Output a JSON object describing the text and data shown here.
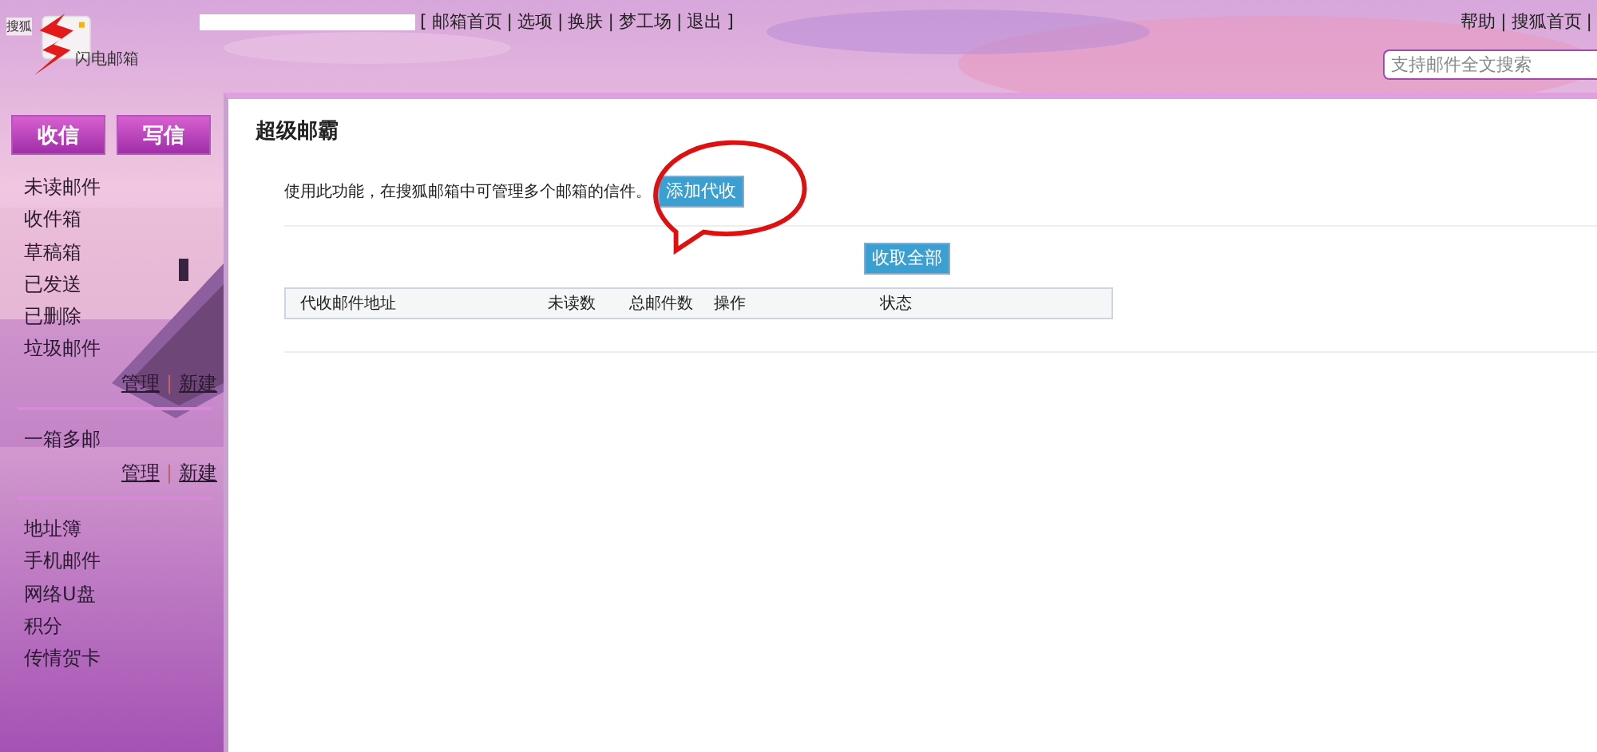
{
  "header": {
    "logo": {
      "brand": "搜狐",
      "product": "闪电邮箱"
    },
    "nav": {
      "open": "[",
      "separator": "|",
      "close": "]",
      "links": [
        "邮箱首页",
        "选项",
        "换肤",
        "梦工场",
        "退出"
      ]
    },
    "right_links": [
      "帮助",
      "搜狐首页"
    ],
    "search": {
      "placeholder": "支持邮件全文搜索"
    }
  },
  "sidebar": {
    "buttons": [
      "收信",
      "写信"
    ],
    "folders": [
      "未读邮件",
      "收件箱",
      "草稿箱",
      "已发送",
      "已删除",
      "垃圾邮件"
    ],
    "folder_actions": [
      "管理",
      "新建"
    ],
    "multi": {
      "label": "一箱多邮",
      "actions": [
        "管理",
        "新建"
      ]
    },
    "tools": [
      "地址簿",
      "手机邮件",
      "网络U盘",
      "积分",
      "传情贺卡"
    ]
  },
  "content": {
    "title": "超级邮霸",
    "description": "使用此功能，在搜狐邮箱中可管理多个邮箱的信件。",
    "add_button": "添加代收",
    "fetch_all_button": "收取全部",
    "table": {
      "columns": [
        "代收邮件地址",
        "未读数",
        "总邮件数",
        "操作",
        "状态"
      ]
    }
  }
}
